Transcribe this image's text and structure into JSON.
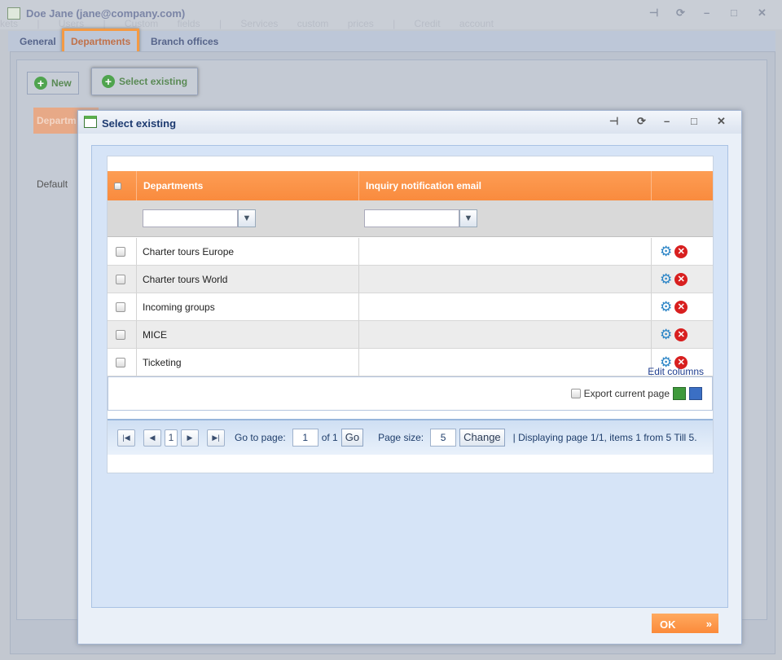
{
  "window": {
    "title": "Doe Jane (jane@company.com)",
    "ghost_tabs": "kets | Users | Custom fields | Services custom prices | Credit account"
  },
  "tabs": [
    {
      "label": "General"
    },
    {
      "label": "Departments"
    },
    {
      "label": "Branch offices"
    }
  ],
  "toolbar": {
    "new_label": "New",
    "select_existing_label": "Select existing"
  },
  "background_grid": {
    "header": "Departm",
    "row": "Default"
  },
  "dialog": {
    "title": "Select existing",
    "columns": [
      "Departments",
      "Inquiry notification email"
    ],
    "rows": [
      {
        "name": "Charter tours Europe",
        "email": ""
      },
      {
        "name": "Charter tours World",
        "email": ""
      },
      {
        "name": "Incoming groups",
        "email": ""
      },
      {
        "name": "MICE",
        "email": ""
      },
      {
        "name": "Ticketing",
        "email": ""
      }
    ],
    "edit_columns": "Edit columns",
    "export_label": "Export current page",
    "pager": {
      "goto_label": "Go to page:",
      "page": "1",
      "of": "of 1",
      "go": "Go",
      "size_label": "Page size:",
      "size": "5",
      "change": "Change",
      "status": "| Displaying page  1/1,  items  1  from  5  Till  5.",
      "current": "1"
    },
    "ok_label": "OK"
  },
  "colors": {
    "accent": "#fb8a3a",
    "header_text": "#1d3a70"
  }
}
